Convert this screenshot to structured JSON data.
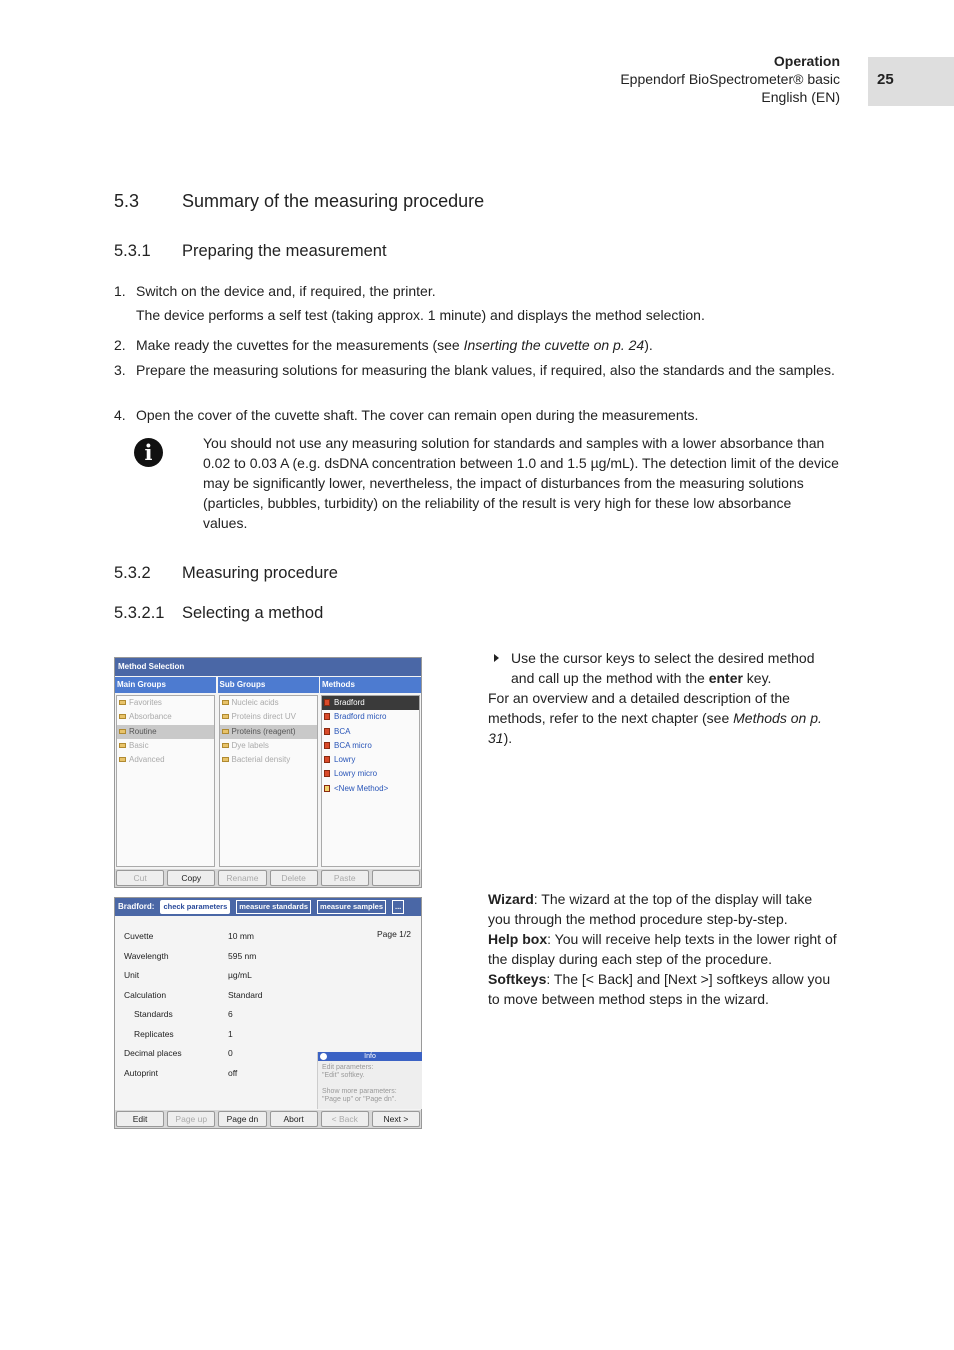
{
  "header": {
    "section": "Operation",
    "product": "Eppendorf BioSpectrometer® basic",
    "language": "English (EN)",
    "page_number": "25"
  },
  "sections": {
    "s53": {
      "num": "5.3",
      "title": "Summary of the measuring procedure"
    },
    "s531": {
      "num": "5.3.1",
      "title": "Preparing the measurement"
    },
    "s532": {
      "num": "5.3.2",
      "title": "Measuring procedure"
    },
    "s5321": {
      "num": "5.3.2.1",
      "title": "Selecting a method"
    }
  },
  "steps": [
    {
      "n": "1.",
      "text": "Switch on the device and, if required, the printer.",
      "sub": "The device performs a self test (taking approx. 1 minute) and displays the method selection."
    },
    {
      "n": "2.",
      "pre": "Make ready the cuvettes for the measurements (see ",
      "ref": "Inserting the cuvette on p. 24",
      "post": ")."
    },
    {
      "n": "3.",
      "text": "Prepare the measuring solutions for measuring the blank values, if required, also the standards and the samples."
    },
    {
      "n": "4.",
      "text": "Open the cover of the cuvette shaft. The cover can remain open during the measurements."
    }
  ],
  "note": {
    "icon": "info-icon",
    "text": "You should not use any measuring solution for standards and samples with a lower absorbance than 0.02 to 0.03 A (e.g. dsDNA concentration between 1.0 and 1.5 µg/mL). The detection limit of the device may be significantly lower, nevertheless, the impact of disturbances from the measuring solutions (particles, bubbles, turbidity) on the reliability of the result is very high for these low absorbance values."
  },
  "screen1": {
    "title": "Method Selection",
    "columns": [
      {
        "header": "Main Groups",
        "items": [
          "Favorites",
          "Absorbance",
          "Routine",
          "Basic",
          "Advanced"
        ],
        "selected": 2
      },
      {
        "header": "Sub Groups",
        "items": [
          "Nucleic acids",
          "Proteins direct UV",
          "Proteins (reagent)",
          "Dye labels",
          "Bacterial density"
        ],
        "selected": 2
      },
      {
        "header": "Methods",
        "items": [
          "Bradford",
          "Bradford micro",
          "BCA",
          "BCA micro",
          "Lowry",
          "Lowry micro",
          "<New Method>"
        ],
        "selected": 0
      }
    ],
    "softkeys": [
      {
        "label": "Cut",
        "enabled": false
      },
      {
        "label": "Copy",
        "enabled": true
      },
      {
        "label": "Rename",
        "enabled": false
      },
      {
        "label": "Delete",
        "enabled": false
      },
      {
        "label": "Paste",
        "enabled": false
      },
      {
        "label": "",
        "enabled": false
      }
    ]
  },
  "screen2": {
    "method": "Bradford:",
    "wizard_steps": [
      "check parameters",
      "measure standards",
      "measure samples",
      "..."
    ],
    "page": "Page 1/2",
    "params": [
      {
        "k": "Cuvette",
        "v": "10 mm"
      },
      {
        "k": "Wavelength",
        "v": "595 nm"
      },
      {
        "k": "Unit",
        "v": "µg/mL"
      },
      {
        "k": "Calculation",
        "v": "Standard"
      },
      {
        "k": "Standards",
        "v": "6",
        "indent": true
      },
      {
        "k": "Replicates",
        "v": "1",
        "indent": true
      },
      {
        "k": "Decimal places",
        "v": "0"
      },
      {
        "k": "Autoprint",
        "v": "off"
      }
    ],
    "info": {
      "title": "Info",
      "line1": "Edit parameters:",
      "line2": "\"Edit\" softkey.",
      "line3": "Show more parameters:",
      "line4": "\"Page up\" or \"Page dn\"."
    },
    "softkeys": [
      {
        "label": "Edit",
        "enabled": true
      },
      {
        "label": "Page up",
        "enabled": false
      },
      {
        "label": "Page dn",
        "enabled": true
      },
      {
        "label": "Abort",
        "enabled": true
      },
      {
        "label": "< Back",
        "enabled": false
      },
      {
        "label": "Next >",
        "enabled": true
      }
    ]
  },
  "right": {
    "instr_pre": "Use the cursor keys to select the desired method and call up the method with the ",
    "instr_bold": "enter",
    "instr_post": " key.",
    "overview_pre": "For an overview and a detailed description of the methods, refer to the next chapter (see ",
    "overview_ref": "Methods on p. 31",
    "overview_post": ").",
    "wizard_label": "Wizard",
    "wizard_text": ": The wizard at the top of the display will take you through the method procedure step-by-step.",
    "help_label": "Help box",
    "help_text": ": You will receive help texts in the lower right of the display during each step of the procedure.",
    "softkeys_label": "Softkeys",
    "softkeys_text": ": The [< Back] and [Next >] softkeys allow you to move between method steps in the wizard."
  }
}
